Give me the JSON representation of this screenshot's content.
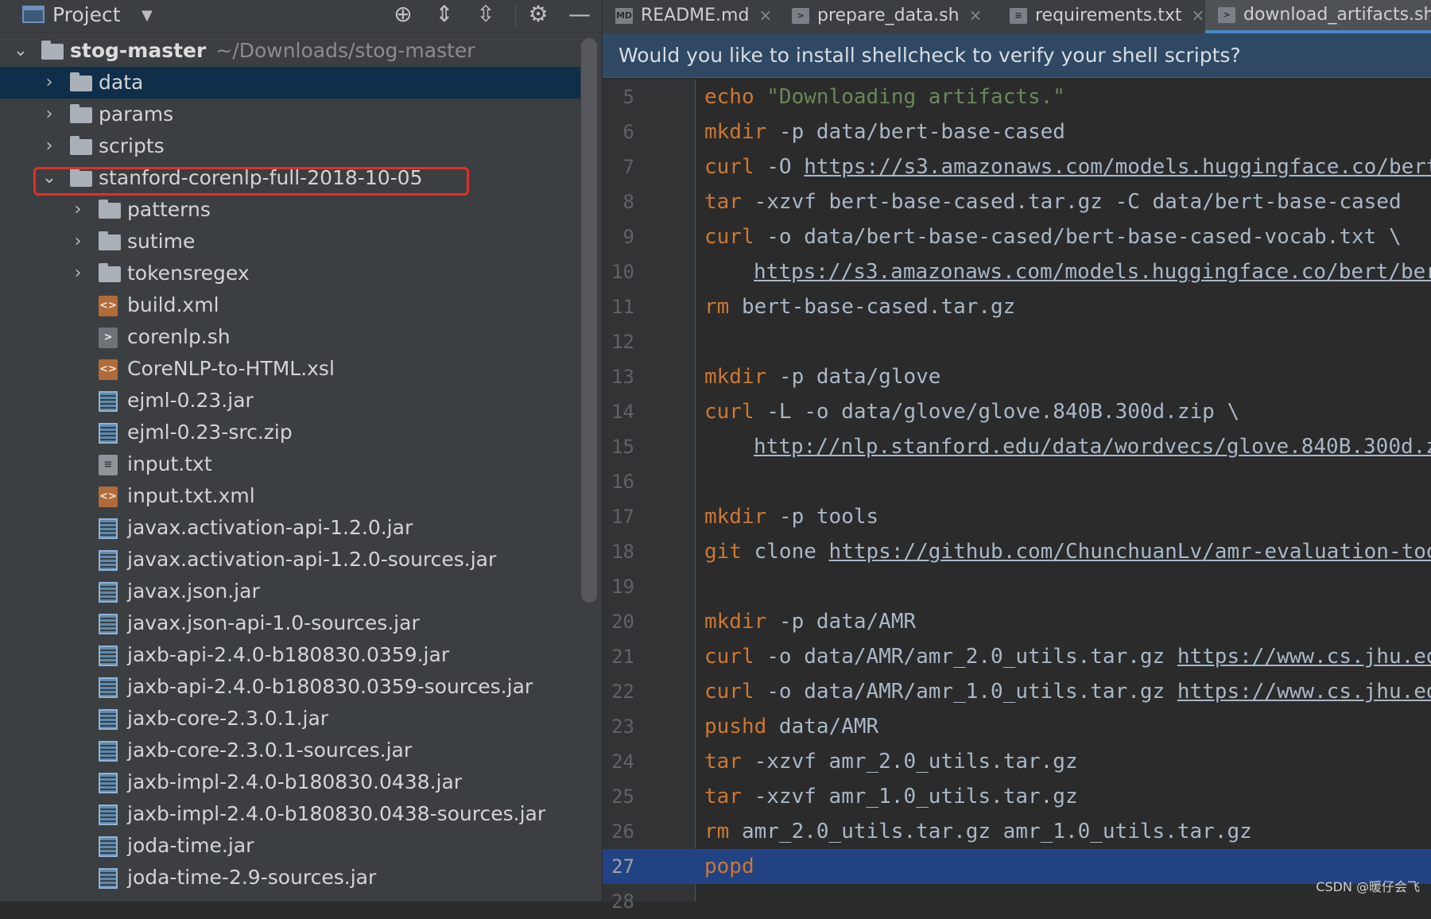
{
  "project_panel": {
    "title": "Project",
    "toolbar_icons": [
      "locate-icon",
      "expand-all-icon",
      "collapse-all-icon",
      "gear-icon",
      "hide-icon"
    ],
    "root": {
      "name": "stog-master",
      "path": "~/Downloads/stog-master"
    },
    "tree": [
      {
        "label": "data",
        "type": "folder",
        "depth": 1,
        "expanded": false,
        "selected": true
      },
      {
        "label": "params",
        "type": "folder",
        "depth": 1,
        "expanded": false
      },
      {
        "label": "scripts",
        "type": "folder",
        "depth": 1,
        "expanded": false
      },
      {
        "label": "stanford-corenlp-full-2018-10-05",
        "type": "folder",
        "depth": 1,
        "expanded": true,
        "highlighted": true
      },
      {
        "label": "patterns",
        "type": "folder",
        "depth": 2,
        "expanded": false
      },
      {
        "label": "sutime",
        "type": "folder",
        "depth": 2,
        "expanded": false
      },
      {
        "label": "tokensregex",
        "type": "folder",
        "depth": 2,
        "expanded": false
      },
      {
        "label": "build.xml",
        "type": "xml",
        "depth": 2
      },
      {
        "label": "corenlp.sh",
        "type": "sh",
        "depth": 2
      },
      {
        "label": "CoreNLP-to-HTML.xsl",
        "type": "xml",
        "depth": 2
      },
      {
        "label": "ejml-0.23.jar",
        "type": "jar",
        "depth": 2
      },
      {
        "label": "ejml-0.23-src.zip",
        "type": "jar",
        "depth": 2
      },
      {
        "label": "input.txt",
        "type": "txt",
        "depth": 2
      },
      {
        "label": "input.txt.xml",
        "type": "xml",
        "depth": 2
      },
      {
        "label": "javax.activation-api-1.2.0.jar",
        "type": "jar",
        "depth": 2
      },
      {
        "label": "javax.activation-api-1.2.0-sources.jar",
        "type": "jar",
        "depth": 2
      },
      {
        "label": "javax.json.jar",
        "type": "jar",
        "depth": 2
      },
      {
        "label": "javax.json-api-1.0-sources.jar",
        "type": "jar",
        "depth": 2
      },
      {
        "label": "jaxb-api-2.4.0-b180830.0359.jar",
        "type": "jar",
        "depth": 2
      },
      {
        "label": "jaxb-api-2.4.0-b180830.0359-sources.jar",
        "type": "jar",
        "depth": 2
      },
      {
        "label": "jaxb-core-2.3.0.1.jar",
        "type": "jar",
        "depth": 2
      },
      {
        "label": "jaxb-core-2.3.0.1-sources.jar",
        "type": "jar",
        "depth": 2
      },
      {
        "label": "jaxb-impl-2.4.0-b180830.0438.jar",
        "type": "jar",
        "depth": 2
      },
      {
        "label": "jaxb-impl-2.4.0-b180830.0438-sources.jar",
        "type": "jar",
        "depth": 2
      },
      {
        "label": "joda-time.jar",
        "type": "jar",
        "depth": 2
      },
      {
        "label": "joda-time-2.9-sources.jar",
        "type": "jar",
        "depth": 2
      }
    ]
  },
  "editor": {
    "tabs": [
      {
        "label": "README.md",
        "icon": "markdown-file-icon",
        "icon_text": "MD",
        "active": false
      },
      {
        "label": "prepare_data.sh",
        "icon": "shell-file-icon",
        "icon_text": ">",
        "active": false
      },
      {
        "label": "requirements.txt",
        "icon": "text-file-icon",
        "icon_text": "≡",
        "active": false
      },
      {
        "label": "download_artifacts.sh",
        "icon": "shell-file-icon",
        "icon_text": ">",
        "active": true
      }
    ],
    "notification": "Would you like to install shellcheck to verify your shell scripts?",
    "current_line": 27,
    "lines": [
      {
        "n": "5",
        "tokens": [
          {
            "t": "echo",
            "c": "kw"
          },
          {
            "t": " "
          },
          {
            "t": "\"Downloading artifacts.\"",
            "c": "str"
          }
        ]
      },
      {
        "n": "6",
        "tokens": [
          {
            "t": "mkdir",
            "c": "kw"
          },
          {
            "t": " -p data/bert-base-cased"
          }
        ]
      },
      {
        "n": "7",
        "tokens": [
          {
            "t": "curl",
            "c": "kw"
          },
          {
            "t": " -O "
          },
          {
            "t": "https://s3.amazonaws.com/models.huggingface.co/bert",
            "c": "url"
          }
        ]
      },
      {
        "n": "8",
        "tokens": [
          {
            "t": "tar",
            "c": "kw"
          },
          {
            "t": " -xzvf bert-base-cased.tar.gz -C data/bert-base-cased"
          }
        ]
      },
      {
        "n": "9",
        "tokens": [
          {
            "t": "curl",
            "c": "kw"
          },
          {
            "t": " -o data/bert-base-cased/bert-base-cased-vocab.txt \\"
          }
        ]
      },
      {
        "n": "10",
        "tokens": [
          {
            "t": "",
            "c": "indent"
          },
          {
            "t": "https://s3.amazonaws.com/models.huggingface.co/bert/ber",
            "c": "url"
          }
        ]
      },
      {
        "n": "11",
        "tokens": [
          {
            "t": "rm",
            "c": "kw"
          },
          {
            "t": " bert-base-cased.tar.gz"
          }
        ]
      },
      {
        "n": "12",
        "tokens": []
      },
      {
        "n": "13",
        "tokens": [
          {
            "t": "mkdir",
            "c": "kw"
          },
          {
            "t": " -p data/glove"
          }
        ]
      },
      {
        "n": "14",
        "tokens": [
          {
            "t": "curl",
            "c": "kw"
          },
          {
            "t": " -L -o data/glove/glove.840B.300d.zip \\"
          }
        ]
      },
      {
        "n": "15",
        "tokens": [
          {
            "t": "",
            "c": "indent"
          },
          {
            "t": "http://nlp.stanford.edu/data/wordvecs/glove.840B.300d.z",
            "c": "url"
          }
        ]
      },
      {
        "n": "16",
        "tokens": []
      },
      {
        "n": "17",
        "tokens": [
          {
            "t": "mkdir",
            "c": "kw"
          },
          {
            "t": " -p tools"
          }
        ]
      },
      {
        "n": "18",
        "tokens": [
          {
            "t": "git",
            "c": "kw"
          },
          {
            "t": " clone "
          },
          {
            "t": "https://github.com/ChunchuanLv/amr-evaluation-too",
            "c": "url"
          }
        ]
      },
      {
        "n": "19",
        "tokens": []
      },
      {
        "n": "20",
        "tokens": [
          {
            "t": "mkdir",
            "c": "kw"
          },
          {
            "t": " -p data/AMR"
          }
        ]
      },
      {
        "n": "21",
        "tokens": [
          {
            "t": "curl",
            "c": "kw"
          },
          {
            "t": " -o data/AMR/amr_2.0_utils.tar.gz "
          },
          {
            "t": "https://www.cs.jhu.ed",
            "c": "url"
          }
        ]
      },
      {
        "n": "22",
        "tokens": [
          {
            "t": "curl",
            "c": "kw"
          },
          {
            "t": " -o data/AMR/amr_1.0_utils.tar.gz "
          },
          {
            "t": "https://www.cs.jhu.ed",
            "c": "url"
          }
        ]
      },
      {
        "n": "23",
        "tokens": [
          {
            "t": "pushd",
            "c": "kw"
          },
          {
            "t": " data/AMR"
          }
        ]
      },
      {
        "n": "24",
        "tokens": [
          {
            "t": "tar",
            "c": "kw"
          },
          {
            "t": " -xzvf amr_2.0_utils.tar.gz"
          }
        ]
      },
      {
        "n": "25",
        "tokens": [
          {
            "t": "tar",
            "c": "kw"
          },
          {
            "t": " -xzvf amr_1.0_utils.tar.gz"
          }
        ]
      },
      {
        "n": "26",
        "tokens": [
          {
            "t": "rm",
            "c": "kw"
          },
          {
            "t": " amr_2.0_utils.tar.gz amr_1.0_utils.tar.gz"
          }
        ]
      },
      {
        "n": "27",
        "tokens": [
          {
            "t": "popd",
            "c": "kw"
          }
        ]
      },
      {
        "n": "28",
        "tokens": []
      }
    ]
  },
  "watermark": "CSDN @暖仔会飞",
  "colors": {
    "panel_bg": "#3c3f41",
    "editor_bg": "#2b2b2b",
    "selection": "#0e2e4a",
    "current_line": "#214283",
    "keyword": "#cc7832",
    "string": "#6a8759",
    "highlight_box": "#e0302a",
    "notification_bg": "#2f4964"
  }
}
